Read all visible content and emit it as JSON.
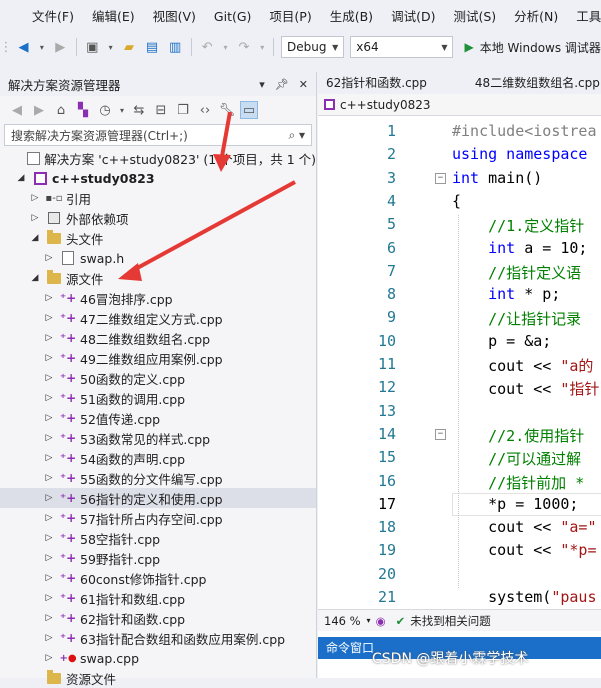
{
  "menu": [
    "文件(F)",
    "编辑(E)",
    "视图(V)",
    "Git(G)",
    "项目(P)",
    "生成(B)",
    "调试(D)",
    "测试(S)",
    "分析(N)",
    "工具("
  ],
  "toolbar": {
    "config": "Debug",
    "platform": "x64",
    "start_label": "本地 Windows 调试器"
  },
  "explorer": {
    "title": "解决方案资源管理器",
    "search_placeholder": "搜索解决方案资源管理器(Ctrl+;)",
    "solution": "解决方案 'c++study0823' (1 个项目，共 1 个)",
    "project": "c++study0823",
    "references": "引用",
    "external_deps": "外部依赖项",
    "headers_folder": "头文件",
    "header_file": "swap.h",
    "sources_folder": "源文件",
    "sources": [
      "46冒泡排序.cpp",
      "47二维数组定义方式.cpp",
      "48二维数组数组名.cpp",
      "49二维数组应用案例.cpp",
      "50函数的定义.cpp",
      "51函数的调用.cpp",
      "52值传递.cpp",
      "53函数常见的样式.cpp",
      "54函数的声明.cpp",
      "55函数的分文件编写.cpp",
      "56指针的定义和使用.cpp",
      "57指针所占内存空间.cpp",
      "58空指针.cpp",
      "59野指针.cpp",
      "60const修饰指针.cpp",
      "61指针和数组.cpp",
      "62指针和函数.cpp",
      "63指针配合数组和函数应用案例.cpp"
    ],
    "error_file": "swap.cpp",
    "resources_folder": "资源文件"
  },
  "editor": {
    "tabs": [
      "62指针和函数.cpp",
      "48二维数组数组名.cpp"
    ],
    "nav_scope": "c++study0823",
    "line_numbers": [
      "1",
      "2",
      "3",
      "4",
      "5",
      "6",
      "7",
      "8",
      "9",
      "10",
      "11",
      "12",
      "13",
      "14",
      "15",
      "16",
      "17",
      "18",
      "19",
      "20",
      "21"
    ],
    "current_line": 17,
    "code": [
      [
        {
          "t": "pp",
          "v": "#include<iostrea"
        }
      ],
      [
        {
          "t": "kw",
          "v": "using namespace"
        }
      ],
      [
        {
          "t": "kw",
          "v": "int"
        },
        {
          "t": "plain",
          "v": " main()"
        }
      ],
      [
        {
          "t": "plain",
          "v": "{"
        }
      ],
      [
        {
          "t": "cm",
          "v": "    //1.定义指针"
        }
      ],
      [
        {
          "t": "kw",
          "v": "    int"
        },
        {
          "t": "plain",
          "v": " a = 10;"
        }
      ],
      [
        {
          "t": "cm",
          "v": "    //指针定义语"
        }
      ],
      [
        {
          "t": "kw",
          "v": "    int"
        },
        {
          "t": "plain",
          "v": " * p;"
        }
      ],
      [
        {
          "t": "cm",
          "v": "    //让指针记录"
        }
      ],
      [
        {
          "t": "plain",
          "v": "    p = &a;"
        }
      ],
      [
        {
          "t": "plain",
          "v": "    cout << "
        },
        {
          "t": "str",
          "v": "\"a的"
        }
      ],
      [
        {
          "t": "plain",
          "v": "    cout << "
        },
        {
          "t": "str",
          "v": "\"指针"
        }
      ],
      [
        {
          "t": "plain",
          "v": ""
        }
      ],
      [
        {
          "t": "cm",
          "v": "    //2.使用指针"
        }
      ],
      [
        {
          "t": "cm",
          "v": "    //可以通过解"
        }
      ],
      [
        {
          "t": "cm",
          "v": "    //指针前加 *"
        }
      ],
      [
        {
          "t": "plain",
          "v": "    *p = 1000;"
        }
      ],
      [
        {
          "t": "plain",
          "v": "    cout << "
        },
        {
          "t": "str",
          "v": "\"a=\""
        }
      ],
      [
        {
          "t": "plain",
          "v": "    cout << "
        },
        {
          "t": "str",
          "v": "\"*p="
        }
      ],
      [
        {
          "t": "plain",
          "v": ""
        }
      ],
      [
        {
          "t": "plain",
          "v": "    system("
        },
        {
          "t": "str",
          "v": "\"paus"
        }
      ]
    ]
  },
  "status": {
    "zoom": "146 %",
    "issues": "未找到相关问题"
  },
  "command_window": "命令窗口",
  "watermark": "CSDN @跟着小霖学技术",
  "colors": {
    "accent": "#1b6fc8",
    "arrow": "#e53935",
    "vs_purple": "#8a2fb1"
  }
}
